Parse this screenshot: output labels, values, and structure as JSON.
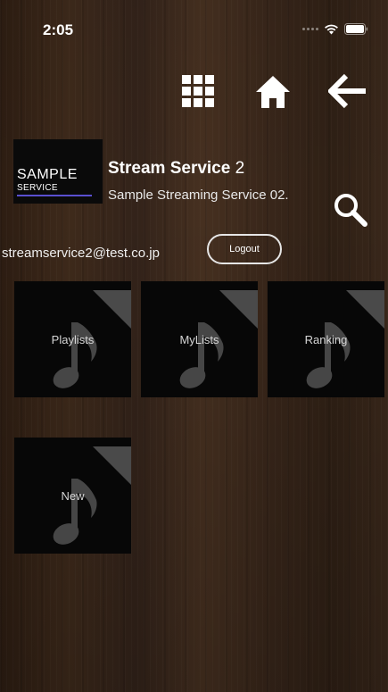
{
  "status_bar": {
    "time": "2:05"
  },
  "nav": {
    "icons": [
      "grid-icon",
      "home-icon",
      "back-arrow-icon"
    ]
  },
  "profile": {
    "logo_line1": "SAMPLE",
    "logo_line2": "SERVICE",
    "title_main": "Stream Service",
    "title_number": "2",
    "description": "Sample Streaming Service 02.",
    "email": "streamservice2@test.co.jp",
    "logout_label": "Logout"
  },
  "tiles": [
    {
      "label": "Playlists",
      "icon": "music-note-icon"
    },
    {
      "label": "MyLists",
      "icon": "music-note-icon"
    },
    {
      "label": "Ranking",
      "icon": "music-note-icon"
    },
    {
      "label": "New",
      "icon": "music-note-icon"
    }
  ],
  "colors": {
    "tile_bg": "#070707",
    "logo_accent": "#5a4fd0",
    "icon_white": "#ffffff"
  }
}
